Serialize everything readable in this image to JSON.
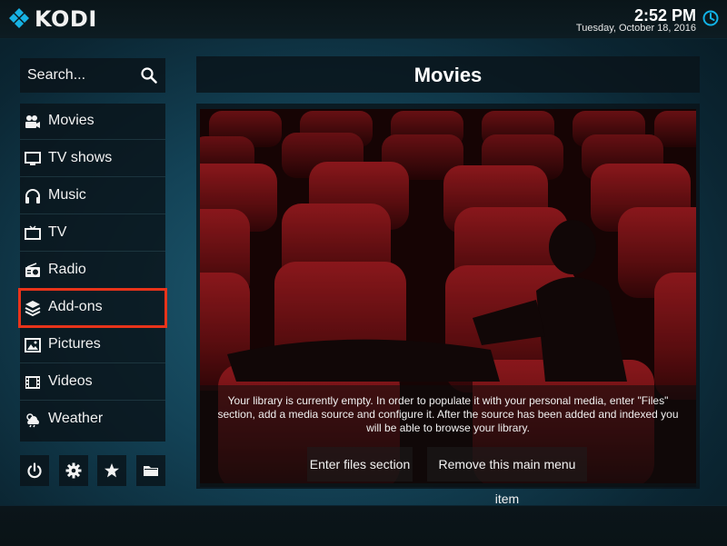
{
  "header": {
    "app_name": "KODI",
    "time": "2:52 PM",
    "date": "Tuesday, October 18, 2016"
  },
  "search": {
    "label": "Search..."
  },
  "menu": {
    "items": [
      {
        "label": "Movies",
        "icon": "movies-icon"
      },
      {
        "label": "TV shows",
        "icon": "tv-shows-icon"
      },
      {
        "label": "Music",
        "icon": "headphones-icon"
      },
      {
        "label": "TV",
        "icon": "tv-icon"
      },
      {
        "label": "Radio",
        "icon": "radio-icon"
      },
      {
        "label": "Add-ons",
        "icon": "addons-icon"
      },
      {
        "label": "Pictures",
        "icon": "pictures-icon"
      },
      {
        "label": "Videos",
        "icon": "videos-icon"
      },
      {
        "label": "Weather",
        "icon": "weather-icon"
      }
    ],
    "highlighted": "Add-ons"
  },
  "footer_buttons": [
    "power-icon",
    "settings-icon",
    "favourites-icon",
    "folder-icon"
  ],
  "main": {
    "title": "Movies",
    "message": "Your library is currently empty. In order to populate it with your personal media, enter \"Files\" section, add a media source and configure it. After the source has been added and indexed you will be able to browse your library.",
    "buttons": {
      "enter_files": "Enter files section",
      "remove_item": "Remove this main menu item"
    }
  },
  "colors": {
    "accent": "#12b2e7",
    "highlight_outline": "#e8331a",
    "seat_red": "#8a1618"
  }
}
